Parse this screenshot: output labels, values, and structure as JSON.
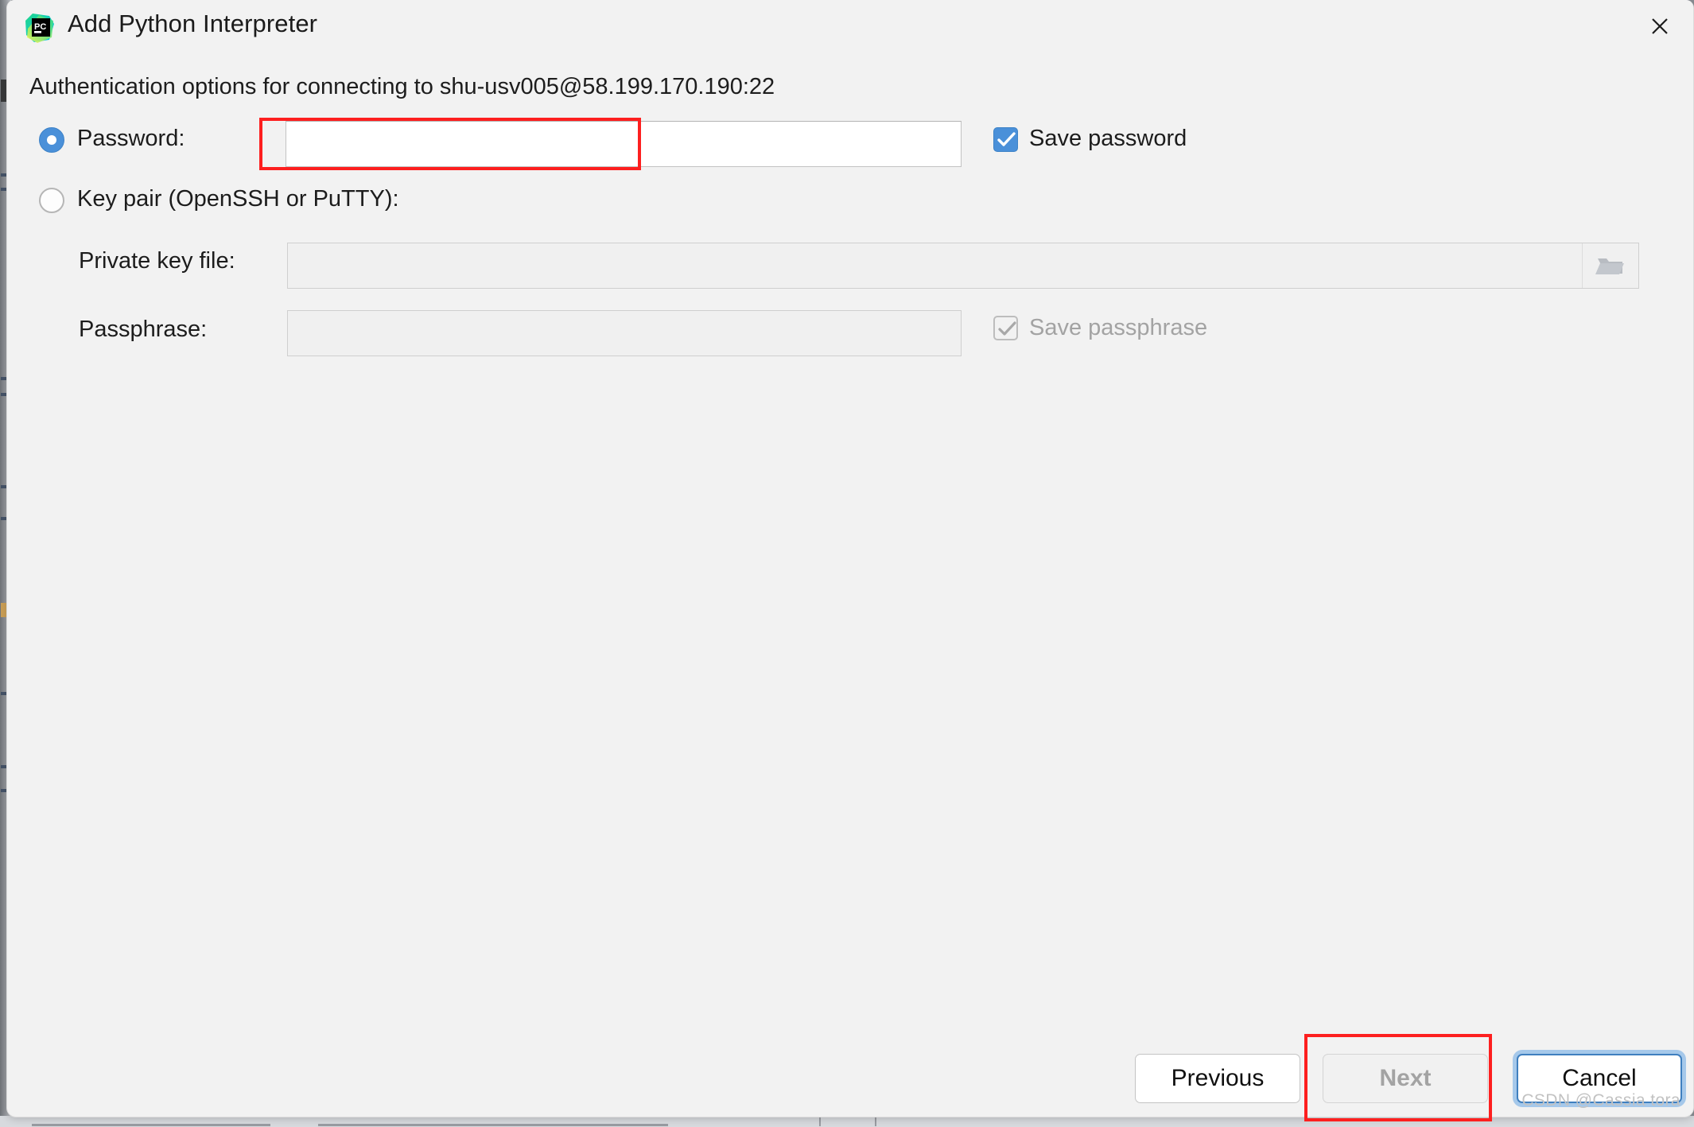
{
  "window": {
    "title": "Add Python Interpreter",
    "app_icon": "pycharm-icon",
    "close_icon": "close-icon"
  },
  "subtitle": "Authentication options for connecting to shu-usv005@58.199.170.190:22",
  "auth": {
    "password_option": {
      "label": "Password:",
      "selected": true,
      "value": "",
      "placeholder": ""
    },
    "save_password": {
      "label": "Save password",
      "checked": true,
      "enabled": true
    },
    "keypair_option": {
      "label": "Key pair (OpenSSH or PuTTY):",
      "selected": false
    },
    "private_key_file": {
      "label": "Private key file:",
      "value": "",
      "placeholder": "",
      "enabled": false,
      "browse_icon": "folder-icon"
    },
    "passphrase": {
      "label": "Passphrase:",
      "value": "",
      "placeholder": "",
      "enabled": false
    },
    "save_passphrase": {
      "label": "Save passphrase",
      "checked": true,
      "enabled": false
    }
  },
  "footer": {
    "previous_label": "Previous",
    "next_label": "Next",
    "next_enabled": false,
    "cancel_label": "Cancel",
    "cancel_focused": true
  },
  "watermark": "CSDN @Cassia tora",
  "colors": {
    "accent": "#4a90d9",
    "annotation": "#fd1f1f",
    "dialog_bg": "#f2f2f2",
    "focus_ring": "#a5c8ea",
    "disabled_text": "#a3a3a3"
  }
}
